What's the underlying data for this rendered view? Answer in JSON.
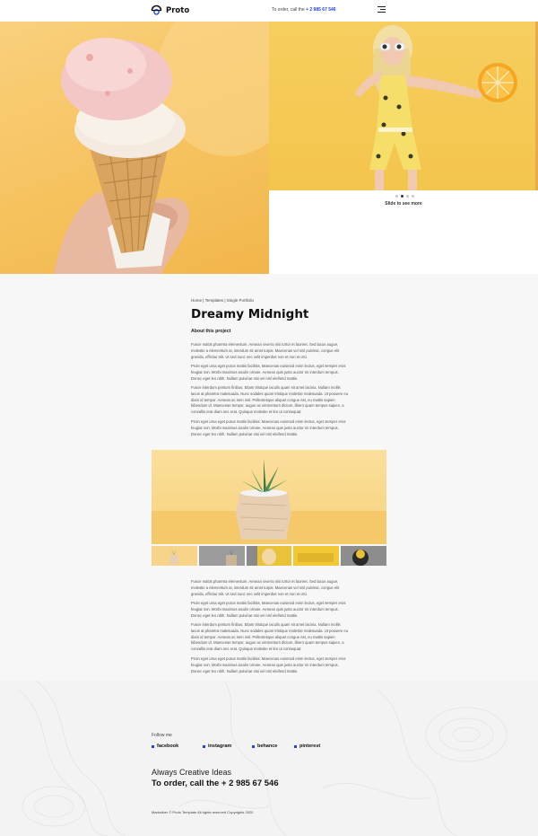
{
  "header": {
    "logo_text": "Proto",
    "order_label": "To order, call the",
    "order_phone": "+ 2 985 67 546"
  },
  "slider": {
    "hint": "Slide to see more",
    "dots": 4,
    "active_dot": 2
  },
  "content": {
    "breadcrumb": "Home | Templates | Single Portfolio",
    "title": "Dreamy Midnight",
    "about_heading": "About this project",
    "paragraphs_top": [
      "Fusce mattis pharetra elementum. Aenean viverra nisi tortor et laoreet. Sed lacus augue, molestie a elementum at, interdum sit amet turpis. Maecenas vel nisl pulvinar, congue elit gravida, efficitur elit. Ut sed nunc nec velit imperdiet non et non et orci.",
      "Proin eget urna eget purus mattis facilisis. Maecenas euismod enim lectus, eget semper eros feugiat non. Morbi maximus iaculis ornare. Aenean quis justo auctor mi interdum tempus. Donec eget leo nibh. Nullam pulvinar nisi vel nisl eleifend mattis.",
      "Fusce interdum pretium finibus. Etiam tristique iaculis quam sit amet lacinia. Nullam mollis lacus at pharetra malesuada. Nunc sodales quam tristique molestie malesuada. Ut posuere eu diam id tempor. Aenean ac sem nisl. Pellentesque aliquet congue est, eu mattis sapien bibendum id. Maecenas tempor, augue ac elementum dictum, libero quam tempus sapien, a convallis erat diam nec erat. Quisque molestie et leo ut consequat.",
      "Proin eget urna eget purus mattis facilisis. Maecenas euismod enim lectus, eget semper eros feugiat non. Morbi maximus iaculis ornare. Aenean quis justo auctor mi interdum tempus. Donec eget leo nibh. Nullam pulvinar nisi vel nisl eleifend mattis."
    ],
    "paragraphs_bottom": [
      "Fusce mattis pharetra elementum. Aenean viverra nisi tortor et laoreet. Sed lacus augue, molestie a elementum at, interdum sit amet turpis. Maecenas vel nisl pulvinar, congue elit gravida, efficitur elit. Ut sed nunc nec velit imperdiet non et non et orci.",
      "Proin eget urna eget purus mattis facilisis. Maecenas euismod enim lectus, eget semper eros feugiat non. Morbi maximus iaculis ornare. Aenean quis justo auctor mi interdum tempus. Donec eget leo nibh. Nullam pulvinar nisi vel nisl eleifend mattis.",
      "Fusce interdum pretium finibus. Etiam tristique iaculis quam sit amet lacinia. Nullam mollis lacus at pharetra malesuada. Nunc sodales quam tristique molestie malesuada. Ut posuere eu diam id tempor. Aenean ac sem nisl. Pellentesque aliquet congue est, eu mattis sapien bibendum id. Maecenas tempor, augue ac elementum dictum, libero quam tempus sapien, a convallis erat diam nec erat. Quisque molestie et leo ut consequat.",
      "Proin eget urna eget purus mattis facilisis. Maecenas euismod enim lectus, eget semper eros feugiat non. Morbi maximus iaculis ornare. Aenean quis justo auctor mi interdum tempus. Donec eget leo nibh. Nullam pulvinar nisi vel nisl eleifend mattis."
    ]
  },
  "footer": {
    "follow_label": "Follow me",
    "socials": [
      "facebook",
      "instagram",
      "behance",
      "pinterest"
    ],
    "tagline": "Always Creative Ideas",
    "order_text": "To order, call the + 2 985 67 546",
    "copyright": "Marksilver © Proto Template All rights reserved Copyrights 2020"
  },
  "colors": {
    "accent": "#2343d8",
    "hero_yellow": "#f6c15c"
  }
}
